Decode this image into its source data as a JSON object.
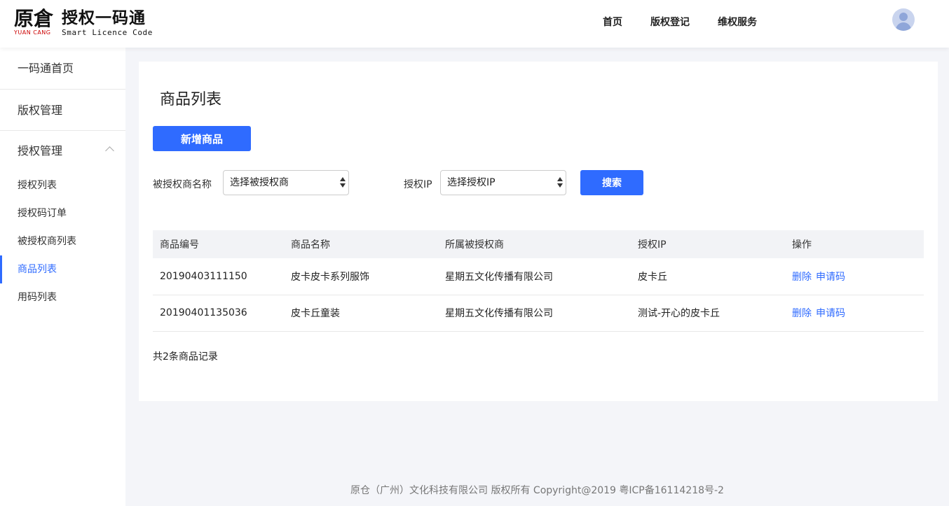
{
  "header": {
    "logo_cn": "原倉",
    "logo_en": "YUAN CANG",
    "brand_title": "授权一码通",
    "brand_subtitle": "Smart Licence Code",
    "nav": [
      "首页",
      "版权登记",
      "维权服务"
    ]
  },
  "sidebar": {
    "home": "一码通首页",
    "copyright": "版权管理",
    "license_group": "授权管理",
    "sub_items": [
      "授权列表",
      "授权码订单",
      "被授权商列表",
      "商品列表",
      "用码列表"
    ],
    "active_index": 3
  },
  "main": {
    "title": "商品列表",
    "add_button": "新增商品",
    "filters": {
      "licensee_label": "被授权商名称",
      "licensee_value": "选择被授权商",
      "ip_label": "授权IP",
      "ip_value": "选择授权IP",
      "search_button": "搜索"
    },
    "table": {
      "headers": [
        "商品编号",
        "商品名称",
        "所属被授权商",
        "授权IP",
        "操作"
      ],
      "rows": [
        {
          "id": "20190403111150",
          "name": "皮卡皮卡系列服饰",
          "licensee": "星期五文化传播有限公司",
          "ip": "皮卡丘",
          "actions": [
            "删除",
            "申请码"
          ]
        },
        {
          "id": "20190401135036",
          "name": "皮卡丘童装",
          "licensee": "星期五文化传播有限公司",
          "ip": "测试-开心的皮卡丘",
          "actions": [
            "删除",
            "申请码"
          ]
        }
      ]
    },
    "summary": "共2条商品记录"
  },
  "footer": "原仓（广州）文化科技有限公司 版权所有 Copyright@2019 粤ICP备16114218号-2",
  "colors": {
    "accent": "#2f6bff",
    "background": "#f4f5f9"
  }
}
